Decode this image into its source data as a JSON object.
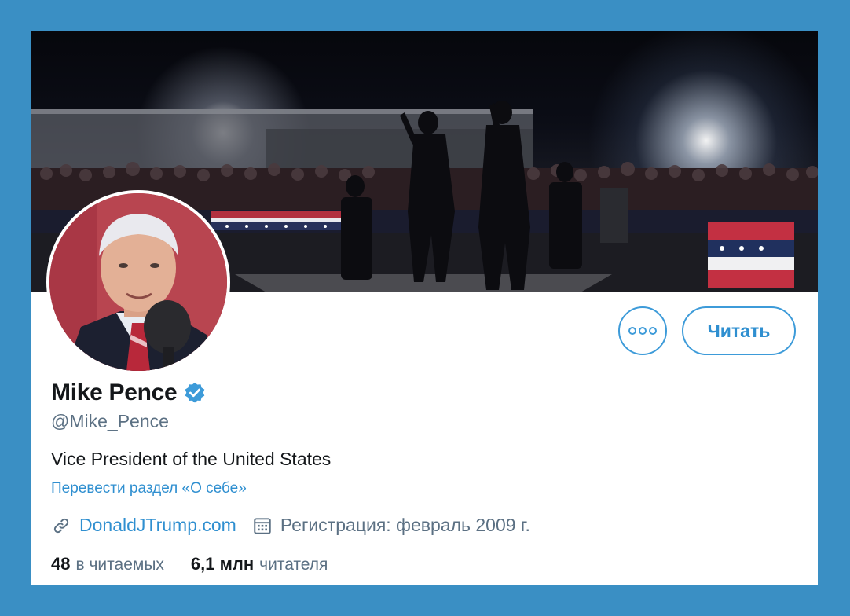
{
  "profile": {
    "name": "Mike Pence",
    "handle": "@Mike_Pence",
    "bio": "Vice President of the United States",
    "translate_link": "Перевести раздел «О себе»",
    "website": "DonaldJTrump.com",
    "joined": "Регистрация: февраль 2009 г.",
    "following_count": "48",
    "following_label": "в читаемых",
    "followers_count": "6,1 млн",
    "followers_label": "читателя"
  },
  "actions": {
    "follow_label": "Читать",
    "more_icon": "more-icon"
  },
  "icons": {
    "verified": "verified-badge-icon",
    "link": "link-icon",
    "calendar": "calendar-icon"
  },
  "colors": {
    "background": "#3a8fc4",
    "accent": "#2f8fd0",
    "text_primary": "#14171a",
    "text_secondary": "#5b7083"
  }
}
